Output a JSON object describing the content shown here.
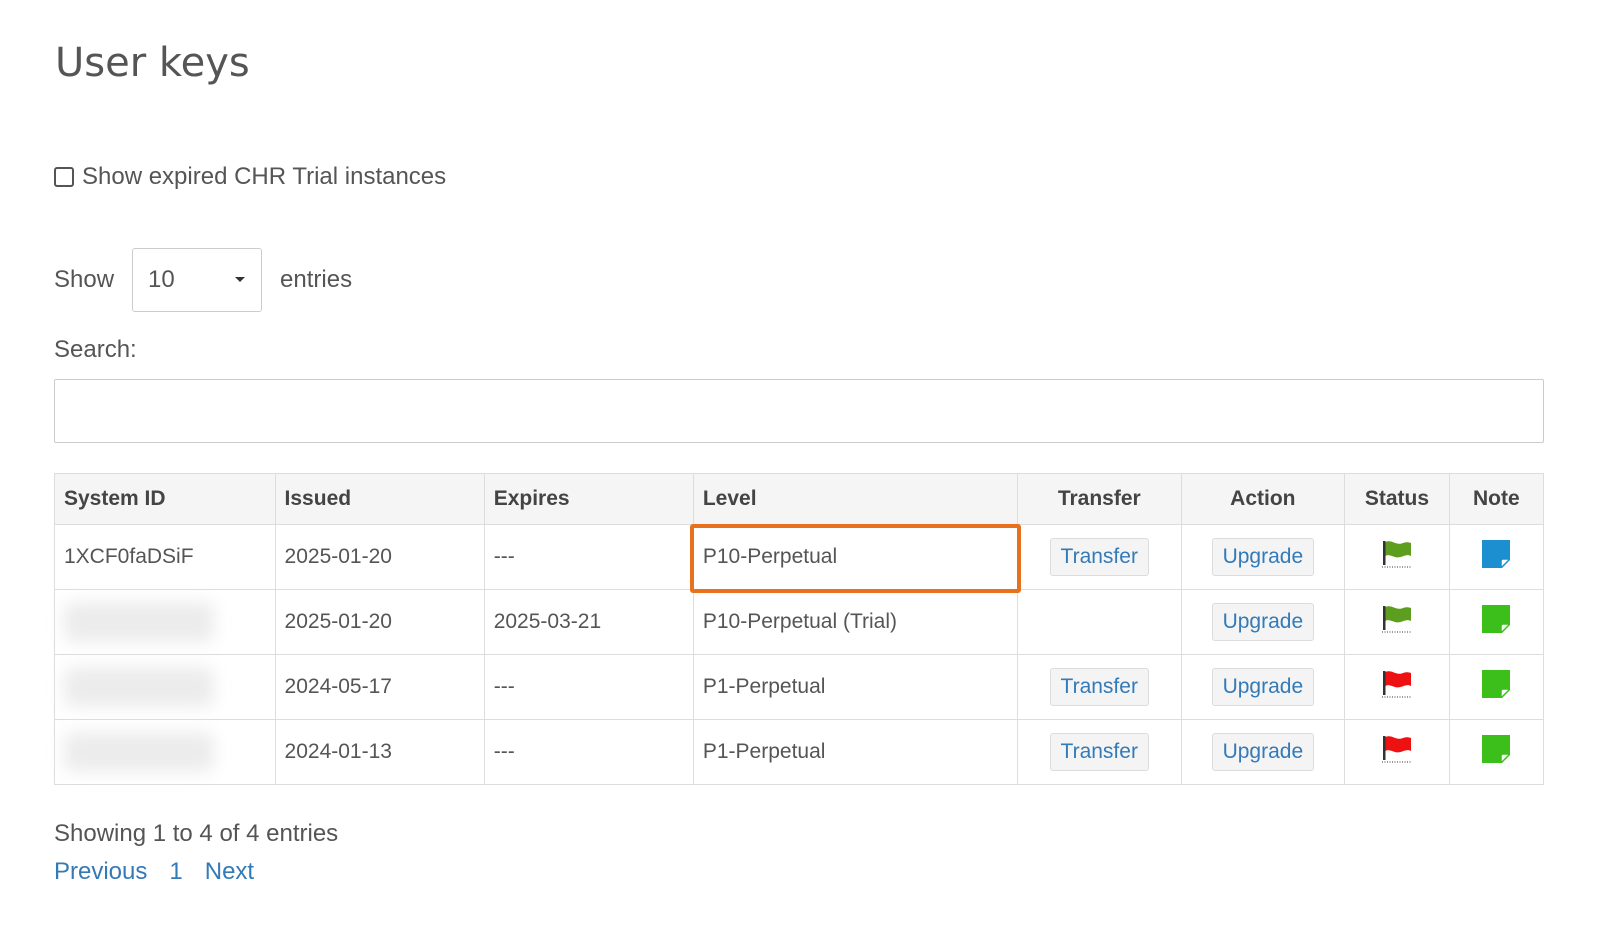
{
  "page": {
    "title": "User keys"
  },
  "filter": {
    "show_expired_label": "Show expired CHR Trial instances",
    "checked": false
  },
  "length": {
    "show_label": "Show",
    "value": "10",
    "entries_label": "entries"
  },
  "search": {
    "label": "Search:",
    "value": ""
  },
  "table": {
    "headers": {
      "system_id": "System ID",
      "issued": "Issued",
      "expires": "Expires",
      "level": "Level",
      "transfer": "Transfer",
      "action": "Action",
      "status": "Status",
      "note": "Note"
    },
    "rows": [
      {
        "system_id": "1XCF0faDSiF",
        "issued": "2025-01-20",
        "expires": "---",
        "level": "P10-Perpetual",
        "transfer": "Transfer",
        "action": "Upgrade",
        "status": "green-flag-icon",
        "note": "blue-note-icon"
      },
      {
        "system_id": "",
        "issued": "2025-01-20",
        "expires": "2025-03-21",
        "level": "P10-Perpetual (Trial)",
        "transfer": "",
        "action": "Upgrade",
        "status": "green-flag-icon",
        "note": "green-note-icon"
      },
      {
        "system_id": "",
        "issued": "2024-05-17",
        "expires": "---",
        "level": "P1-Perpetual",
        "transfer": "Transfer",
        "action": "Upgrade",
        "status": "red-flag-icon",
        "note": "green-note-icon"
      },
      {
        "system_id": "",
        "issued": "2024-01-13",
        "expires": "---",
        "level": "P1-Perpetual",
        "transfer": "Transfer",
        "action": "Upgrade",
        "status": "red-flag-icon",
        "note": "green-note-icon"
      }
    ]
  },
  "info": "Showing 1 to 4 of 4 entries",
  "pagination": {
    "previous": "Previous",
    "page": "1",
    "next": "Next"
  },
  "colors": {
    "highlight": "#e8711e",
    "link": "#337ab7",
    "flag_green": "#5e9e1f",
    "flag_red": "#ee1111",
    "note_blue": "#1b8fd0",
    "note_green": "#3cbf1a"
  }
}
